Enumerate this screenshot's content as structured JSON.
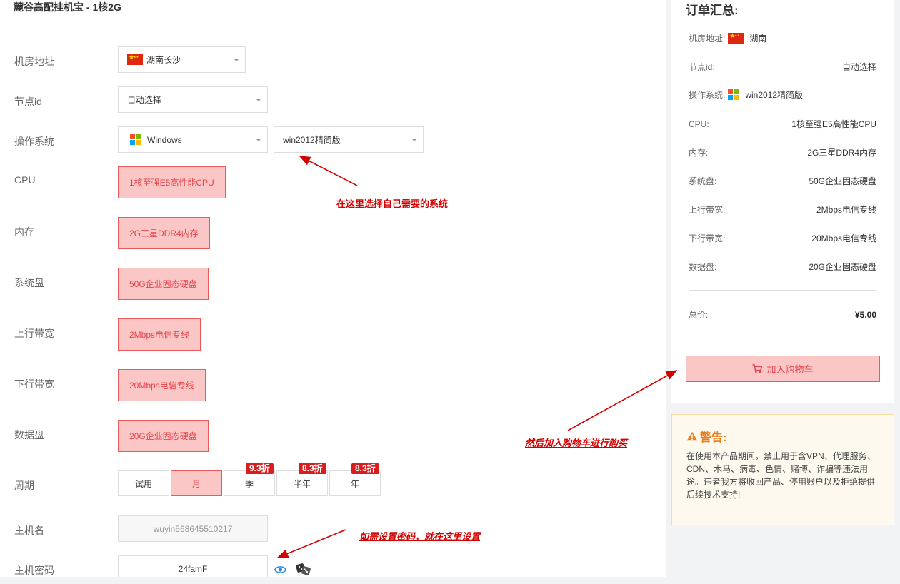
{
  "product": {
    "title": "麓谷高配挂机宝 - 1核2G"
  },
  "form": {
    "location_label": "机房地址",
    "location_value": "湖南长沙",
    "node_label": "节点id",
    "node_value": "自动选择",
    "os_label": "操作系统",
    "os_family": "Windows",
    "os_version": "win2012精简版",
    "cpu_label": "CPU",
    "cpu_value": "1核至强E5高性能CPU",
    "memory_label": "内存",
    "memory_value": "2G三星DDR4内存",
    "sysdisk_label": "系统盘",
    "sysdisk_value": "50G企业固态硬盘",
    "upbw_label": "上行带宽",
    "upbw_value": "2Mbps电信专线",
    "downbw_label": "下行带宽",
    "downbw_value": "20Mbps电信专线",
    "datadisk_label": "数据盘",
    "datadisk_value": "20G企业固态硬盘",
    "cycle_label": "周期",
    "cycles": [
      {
        "label": "试用",
        "discount": "",
        "active": false
      },
      {
        "label": "月",
        "discount": "",
        "active": true
      },
      {
        "label": "季",
        "discount": "9.3折",
        "active": false
      },
      {
        "label": "半年",
        "discount": "8.3折",
        "active": false
      },
      {
        "label": "年",
        "discount": "8.3折",
        "active": false
      }
    ],
    "hostname_label": "主机名",
    "hostname_value": "wuyin568645510217",
    "password_label": "主机密码",
    "password_value": "24famF"
  },
  "annotations": {
    "select_os": "在这里选择自己需要的系统",
    "add_cart": "然后加入购物车进行购买",
    "set_password": "如需设置密码，就在这里设置"
  },
  "summary": {
    "title": "订单汇总:",
    "location_key": "机房地址:",
    "location_val": "湖南",
    "node_key": "节点id:",
    "node_val": "自动选择",
    "os_key": "操作系统:",
    "os_val": "win2012精简版",
    "cpu_key": "CPU:",
    "cpu_val": "1核至强E5高性能CPU",
    "mem_key": "内存:",
    "mem_val": "2G三星DDR4内存",
    "sysdisk_key": "系统盘:",
    "sysdisk_val": "50G企业固态硬盘",
    "up_key": "上行带宽:",
    "up_val": "2Mbps电信专线",
    "down_key": "下行带宽:",
    "down_val": "20Mbps电信专线",
    "data_key": "数据盘:",
    "data_val": "20G企业固态硬盘",
    "total_key": "总价:",
    "total_val": "¥5.00",
    "cart_button": "加入购物车"
  },
  "warning": {
    "title": "警告:",
    "body": "在使用本产品期间，禁止用于含VPN、代理服务、CDN、木马、病毒、色情、赌博、诈骗等违法用途。违者我方将收回产品、停用账户以及拒绝提供后续技术支持!"
  },
  "colors": {
    "accent": "#e5444a",
    "accent_bg": "#fbc6c6",
    "annotation": "#d40000",
    "warning": "#e67e22"
  }
}
